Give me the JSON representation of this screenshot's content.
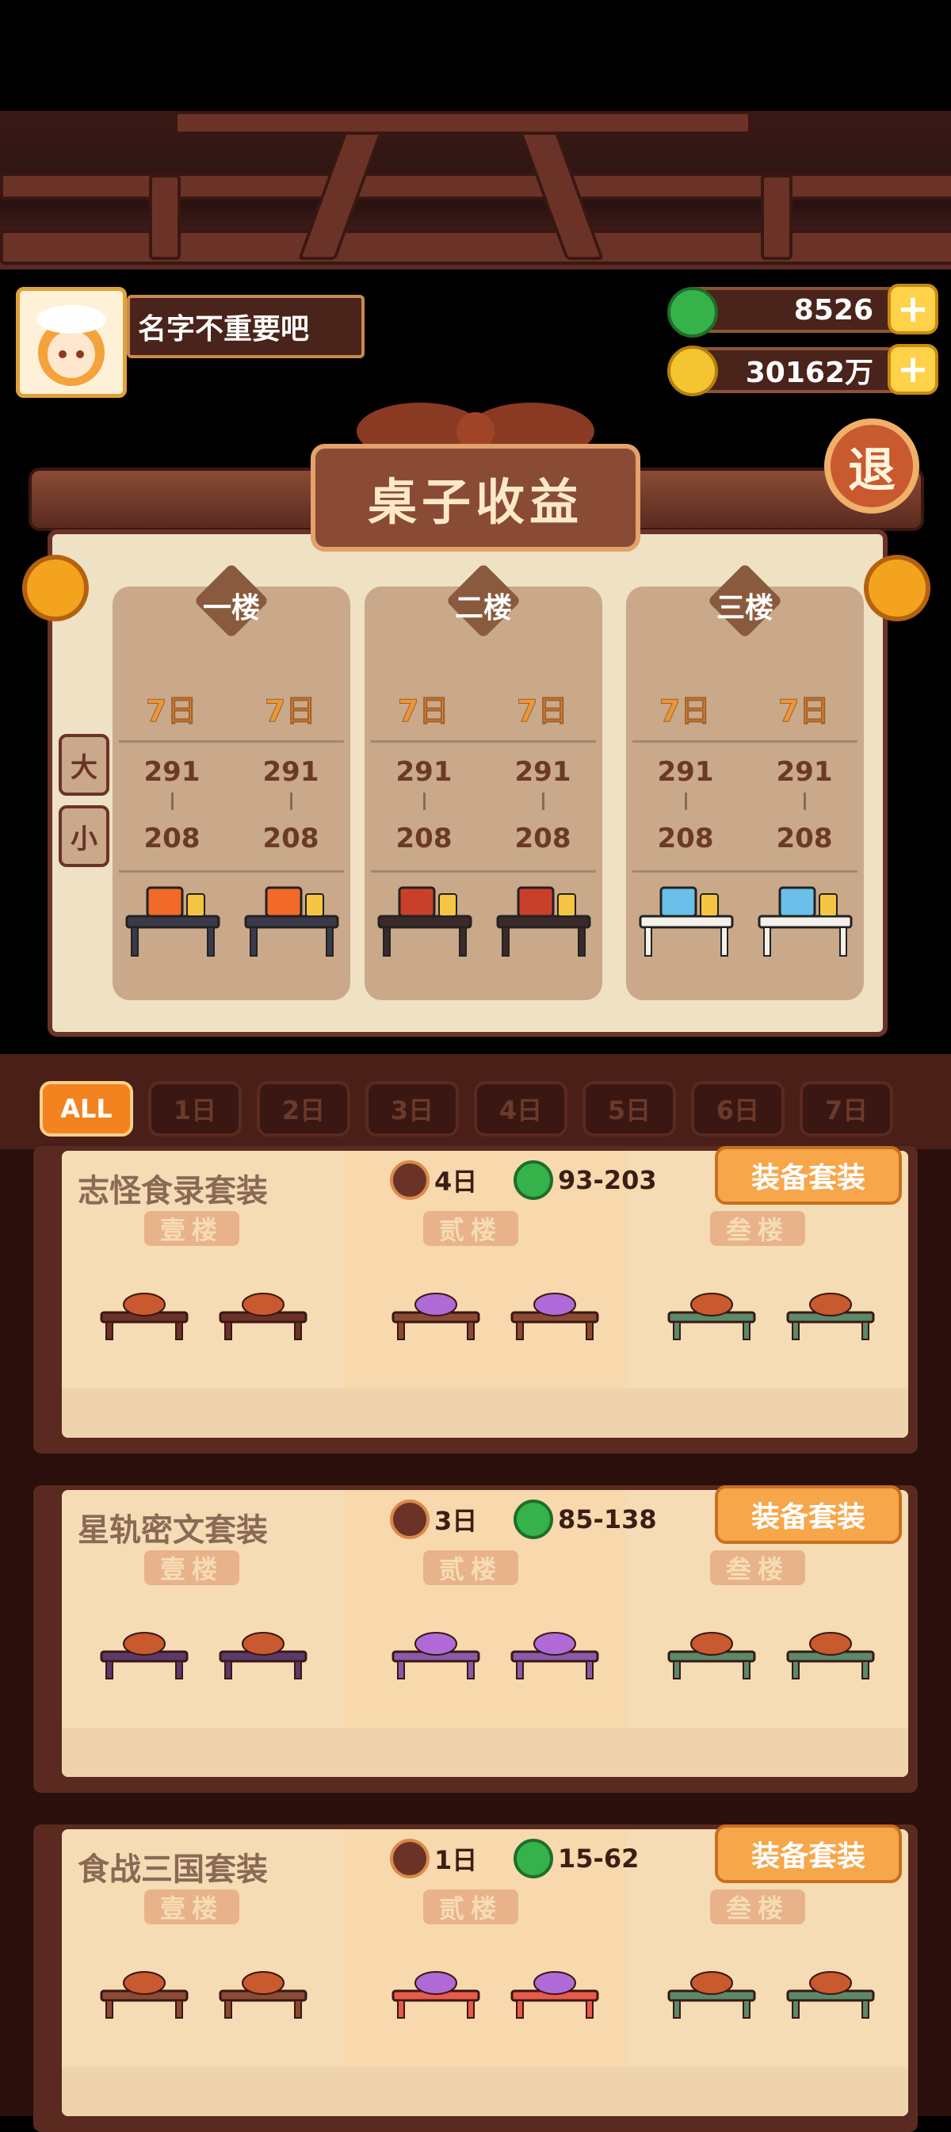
{
  "profile": {
    "name": "名字不重要吧"
  },
  "currency": {
    "jade": "8526",
    "coins": "30162万",
    "plus": "+"
  },
  "board": {
    "title": "桌子收益",
    "exit": "退"
  },
  "side": {
    "big": "大",
    "small": "小"
  },
  "floors": [
    {
      "label": "一楼",
      "days": [
        "7日",
        "7日"
      ],
      "big": [
        "291",
        "291"
      ],
      "small": [
        "208",
        "208"
      ],
      "kind": "kiosk"
    },
    {
      "label": "二楼",
      "days": [
        "7日",
        "7日"
      ],
      "big": [
        "291",
        "291"
      ],
      "small": [
        "208",
        "208"
      ],
      "kind": "coffee"
    },
    {
      "label": "三楼",
      "days": [
        "7日",
        "7日"
      ],
      "big": [
        "291",
        "291"
      ],
      "small": [
        "208",
        "208"
      ],
      "kind": "computer"
    }
  ],
  "tabs": [
    "ALL",
    "1日",
    "2日",
    "3日",
    "4日",
    "5日",
    "6日",
    "7日"
  ],
  "sets": [
    {
      "name": "志怪食录套装",
      "days": "4日",
      "range": "93-203",
      "equip": "装备套装",
      "floors": [
        "壹楼",
        "贰楼",
        "叁楼"
      ]
    },
    {
      "name": "星轨密文套装",
      "days": "3日",
      "range": "85-138",
      "equip": "装备套装",
      "floors": [
        "壹楼",
        "贰楼",
        "叁楼"
      ]
    },
    {
      "name": "食战三国套装",
      "days": "1日",
      "range": "15-62",
      "equip": "装备套装",
      "floors": [
        "壹楼",
        "贰楼",
        "叁楼"
      ]
    }
  ],
  "colors": {
    "accent": "#f3831e",
    "wood": "#6b3327",
    "parchment": "#efe1c4"
  }
}
